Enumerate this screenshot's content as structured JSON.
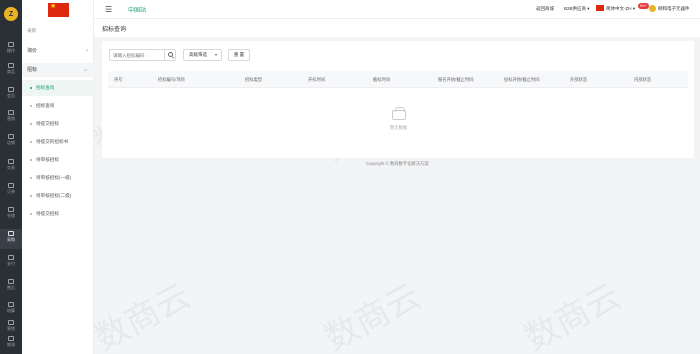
{
  "rail": {
    "logo": "Z",
    "items": [
      {
        "label": "操作",
        "icon": "home-icon"
      },
      {
        "label": "商品",
        "icon": "goods-icon"
      },
      {
        "label": "会员",
        "icon": "member-icon"
      },
      {
        "label": "营销",
        "icon": "marketing-icon"
      },
      {
        "label": "店铺",
        "icon": "shop-icon"
      },
      {
        "label": "交易",
        "icon": "trade-icon"
      },
      {
        "label": "订单",
        "icon": "order-icon"
      },
      {
        "label": "仓储",
        "icon": "warehouse-icon"
      },
      {
        "label": "采购",
        "icon": "purchase-icon"
      },
      {
        "label": "支付",
        "icon": "pay-icon"
      },
      {
        "label": "售后",
        "icon": "aftersale-icon"
      },
      {
        "label": "结算",
        "icon": "settle-icon"
      },
      {
        "label": "营销",
        "icon": "promo-icon"
      },
      {
        "label": "物流",
        "icon": "logistics-icon"
      }
    ]
  },
  "sidebar": {
    "section": "采购",
    "groups": [
      {
        "label": "询价",
        "chevron": "›"
      },
      {
        "label": "招标",
        "chevron": "⌄"
      }
    ],
    "items": [
      "招标查询",
      "招标查询",
      "待提交招标",
      "待提交的招标书",
      "待审核招标",
      "待审核招标(一级)",
      "待审核招标(二级)",
      "待提交招标"
    ],
    "colors": {
      "active": "#1a9c7a",
      "rail": "#2b2f36"
    }
  },
  "topbar": {
    "site": "中国站",
    "links": [
      "返回商城",
      "B2B供应商 ▾"
    ],
    "lang": "简体中文-ZH ▾",
    "badge": "99+",
    "user": "颐和电子元器件"
  },
  "page": {
    "title": "招标查询"
  },
  "toolbar": {
    "search_placeholder": "请输入招标编码",
    "filter_label": "高级筛选",
    "filter_caret": "▾",
    "reset_label": "重 置"
  },
  "table": {
    "columns": [
      "序号",
      "招标编号/项目",
      "招标类型",
      "开标时间",
      "截标时间",
      "报名开始/截止时间",
      "投标开始/截止时间",
      "外部状态",
      "内部状态"
    ],
    "empty_text": "暂无数据"
  },
  "footer": {
    "copyright": "Copyright © 数商数字化解决方案"
  },
  "watermark": "数商云"
}
